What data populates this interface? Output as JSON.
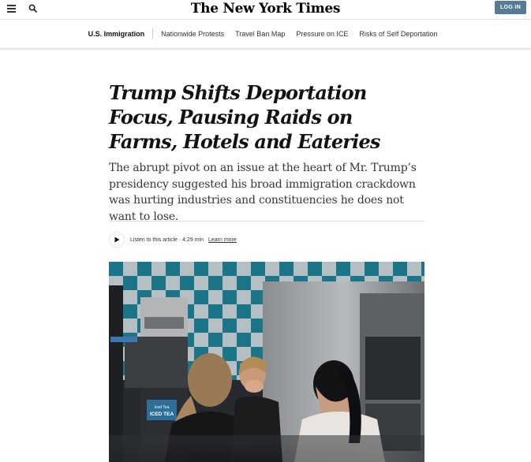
{
  "header": {
    "masthead": "The New York Times",
    "login_label": "LOG IN",
    "icons": {
      "menu": "hamburger-menu-icon",
      "search": "search-icon"
    },
    "login_color": "#567b95"
  },
  "nav": {
    "current": "U.S. Immigration",
    "items": [
      "Nationwide Protests",
      "Travel Ban Map",
      "Pressure on ICE",
      "Risks of Self Deportation"
    ]
  },
  "article": {
    "headline": "Trump Shifts Deportation Focus, Pausing Raids on Farms, Hotels and Eateries",
    "summary": "The abrupt pivot on an issue at the heart of Mr. Trump’s presidency suggested his broad immigration crackdown was hurting industries and constituencies he does not want to lose.",
    "audio": {
      "label": "Listen to this article · 4:29 min",
      "learn_more": "Learn more",
      "icon": "play-icon"
    },
    "photo": {
      "sign_line1": "Iced Tea",
      "sign_line2": "ICED TEA"
    }
  }
}
